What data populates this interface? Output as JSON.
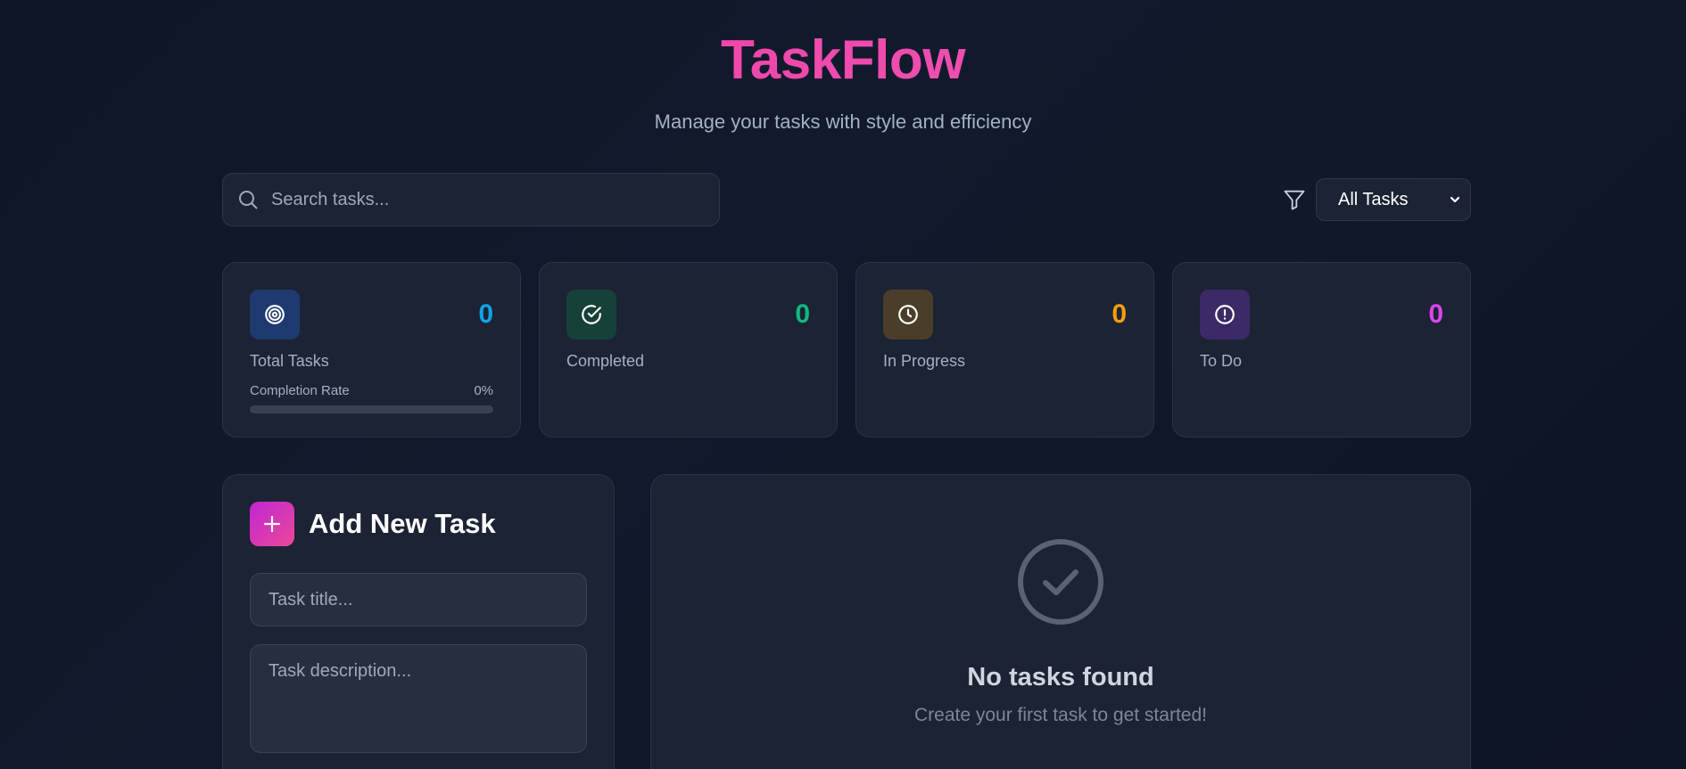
{
  "header": {
    "title": "TaskFlow",
    "subtitle": "Manage your tasks with style and efficiency"
  },
  "search": {
    "placeholder": "Search tasks...",
    "value": ""
  },
  "filter": {
    "selected": "All Tasks",
    "icon": "filter-icon"
  },
  "stats": {
    "total": {
      "value": "0",
      "label": "Total Tasks",
      "icon": "target-icon",
      "color": "#0ea5e9",
      "icon_bg": "#1e3a6e"
    },
    "completed": {
      "value": "0",
      "label": "Completed",
      "icon": "check-circle-icon",
      "color": "#10b981",
      "icon_bg": "#164138"
    },
    "in_progress": {
      "value": "0",
      "label": "In Progress",
      "icon": "clock-icon",
      "color": "#f59e0b",
      "icon_bg": "#4a3e2a"
    },
    "todo": {
      "value": "0",
      "label": "To Do",
      "icon": "alert-circle-icon",
      "color": "#d946ef",
      "icon_bg": "#3b2a66"
    },
    "completion_rate": {
      "label": "Completion Rate",
      "value_text": "0%",
      "fraction": 0
    }
  },
  "add_task": {
    "title": "Add New Task",
    "title_placeholder": "Task title...",
    "description_placeholder": "Task description..."
  },
  "empty_state": {
    "title": "No tasks found",
    "subtitle": "Create your first task to get started!",
    "icon": "check-circle-icon"
  },
  "colors": {
    "accent_pink": "#ec4899",
    "background": "#0f1626",
    "card": "#1c2334"
  }
}
